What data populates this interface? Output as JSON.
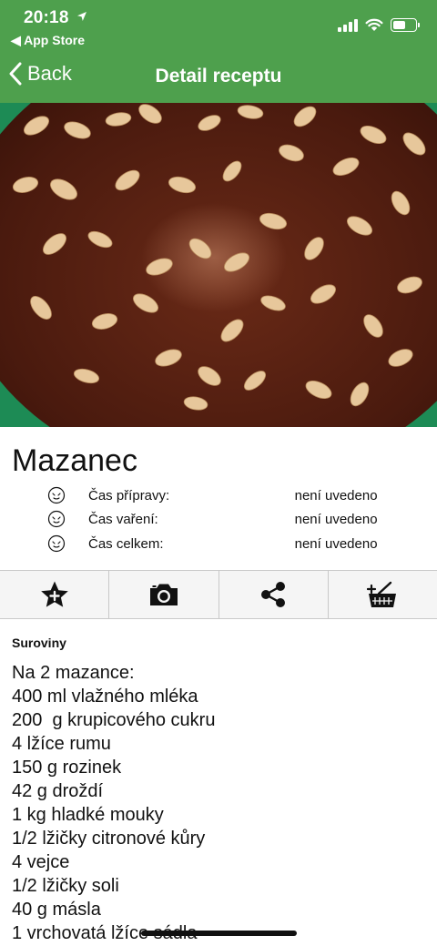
{
  "status_bar": {
    "time": "20:18",
    "back_app": "◀ App Store"
  },
  "nav": {
    "back_label": "Back",
    "title": "Detail receptu"
  },
  "recipe": {
    "title": "Mazanec",
    "times": [
      {
        "label": "Čas přípravy:",
        "value": "není uvedeno"
      },
      {
        "label": "Čas vaření:",
        "value": "není uvedeno"
      },
      {
        "label": "Čas celkem:",
        "value": "není uvedeno"
      }
    ]
  },
  "actions": [
    {
      "icon": "star-add-icon"
    },
    {
      "icon": "camera-icon"
    },
    {
      "icon": "share-icon"
    },
    {
      "icon": "basket-add-icon"
    }
  ],
  "ingredients": {
    "section_label": "Suroviny",
    "items": [
      "Na 2 mazance:",
      "400 ml vlažného mléka",
      "200  g krupicového cukru",
      "4 lžíce rumu",
      "150 g rozinek",
      "42 g droždí",
      "1 kg hladké mouky",
      "1/2 lžičky citronové kůry",
      "4 vejce",
      "1/2 lžičky soli",
      "40 g másla",
      "1 vrchovatá lžíce sádla"
    ]
  },
  "colors": {
    "nav_green": "#4ea04d",
    "hero_background": "#1d8b55",
    "bread_crust": "#4a1a0e"
  }
}
